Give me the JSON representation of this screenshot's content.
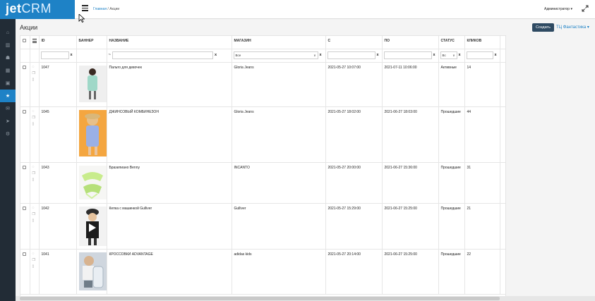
{
  "brand": {
    "part1": "jet",
    "part2": "CRM"
  },
  "breadcrumb": {
    "home": "Главная",
    "separator": "/",
    "current": "Акции"
  },
  "user": {
    "name": "Администратор",
    "caret": "▾"
  },
  "sidebar": {
    "items": [
      {
        "icon": "bank-icon",
        "glyph": "⌂"
      },
      {
        "icon": "chart-icon",
        "glyph": "▥"
      },
      {
        "icon": "users-icon",
        "glyph": "☗"
      },
      {
        "icon": "grid-icon",
        "glyph": "▦"
      },
      {
        "icon": "gift-icon",
        "glyph": "▣"
      },
      {
        "icon": "star-icon",
        "glyph": "★"
      },
      {
        "icon": "mail-icon",
        "glyph": "✉"
      },
      {
        "icon": "send-icon",
        "glyph": "➤"
      },
      {
        "icon": "gears-icon",
        "glyph": "⚙"
      }
    ],
    "active_index": 5
  },
  "page": {
    "title": "Акции",
    "create_label": "Создать",
    "mall_label": "ТЦ Фантастика ▾"
  },
  "table": {
    "columns": {
      "id": "ID",
      "banner": "Баннер",
      "name": "Название",
      "shop": "Магазин",
      "from": "С",
      "to": "По",
      "status": "Статус",
      "clicks": "Кликов"
    },
    "filters": {
      "clear": "x",
      "name_op": "~",
      "shop_value": "Все",
      "status_value": "Вс",
      "select_caret": "∨"
    },
    "rows": [
      {
        "id": "1047",
        "name": "Пальто для девочек",
        "shop": "Gloria Jeans",
        "from": "2021-05-27 10:07:00",
        "to": "2021-07-11 10:06:00",
        "status": "Активные",
        "clicks": "14"
      },
      {
        "id": "1045",
        "name": "ДЖИНСОВЫЙ КОМБИНЕЗОН",
        "shop": "Gloria Jeans",
        "from": "2021-05-27 18:02:00",
        "to": "2021-06-27 18:03:00",
        "status": "Прошедшие",
        "clicks": "44"
      },
      {
        "id": "1043",
        "name": "Бразилиано Benny",
        "shop": "INCANTO",
        "from": "2021-05-27 20:00:00",
        "to": "2021-06-27 15:36:00",
        "status": "Прошедшие",
        "clicks": "31"
      },
      {
        "id": "1042",
        "name": "Кепка с машинкой Gulliver",
        "shop": "Gulliver",
        "from": "2021-05-27 15:29:00",
        "to": "2021-06-27 15:25:00",
        "status": "Прошедшие",
        "clicks": "21"
      },
      {
        "id": "1041",
        "name": "КРОССОВКИ ADVANTAGE",
        "shop": "adidas kids",
        "from": "2021-05-27 20:14:00",
        "to": "2021-06-27 15:25:00",
        "status": "Прошедшие",
        "clicks": "22"
      }
    ]
  }
}
